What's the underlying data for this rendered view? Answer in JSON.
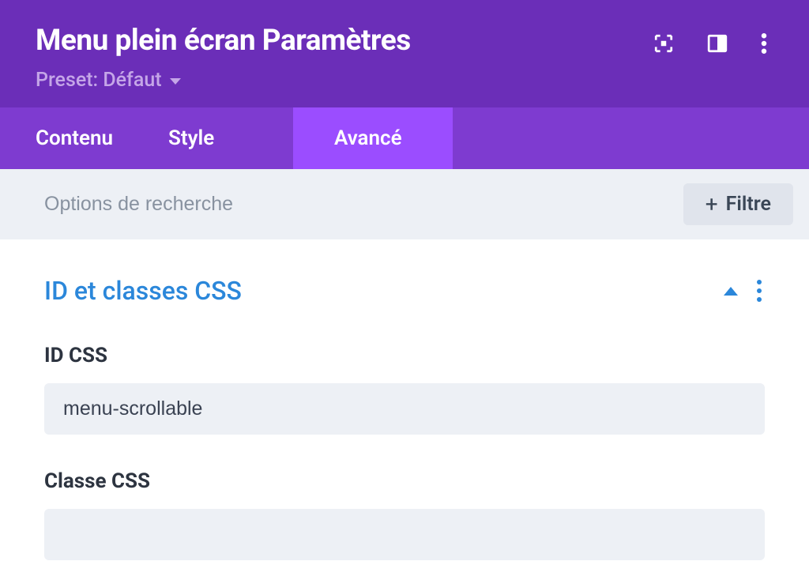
{
  "header": {
    "title": "Menu plein écran Paramètres",
    "preset_label": "Preset: Défaut"
  },
  "tabs": {
    "content": "Contenu",
    "style": "Style",
    "advanced": "Avancé"
  },
  "search": {
    "placeholder": "Options de recherche",
    "filter_label": "Filtre"
  },
  "section": {
    "title": "ID et classes CSS"
  },
  "fields": {
    "id_label": "ID CSS",
    "id_value": "menu-scrollable",
    "class_label": "Classe CSS",
    "class_value": ""
  }
}
